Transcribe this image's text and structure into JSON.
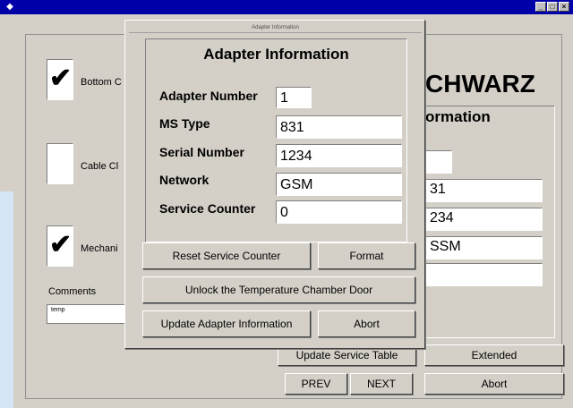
{
  "main_window": {
    "title": "",
    "title_buttons": [
      "_",
      "□",
      "×"
    ],
    "checkboxes": [
      {
        "label": "Bottom C",
        "checked": true
      },
      {
        "label": "Cable Cl",
        "checked": false
      },
      {
        "label": "Mechani",
        "checked": true
      }
    ],
    "comments_label": "Comments",
    "comments_value": "temp",
    "brand_partial": "CHWARZ",
    "info_title_partial": "ormation",
    "bg_values": [
      "",
      "31",
      "234",
      "SSM",
      ""
    ],
    "buttons": {
      "update_service_table": "Update Service Table",
      "extended": "Extended",
      "prev": "PREV",
      "next": "NEXT",
      "abort": "Abort"
    }
  },
  "dialog": {
    "title": "Adapter Information",
    "heading": "Adapter Information",
    "fields": [
      {
        "label": "Adapter Number",
        "value": "1"
      },
      {
        "label": "MS Type",
        "value": "831"
      },
      {
        "label": "Serial Number",
        "value": "1234"
      },
      {
        "label": "Network",
        "value": "GSM"
      },
      {
        "label": "Service Counter",
        "value": "0"
      }
    ],
    "buttons": {
      "reset_service_counter": "Reset Service Counter",
      "format": "Format",
      "unlock_door": "Unlock the Temperature Chamber Door",
      "update_adapter_info": "Update Adapter Information",
      "abort": "Abort"
    }
  }
}
